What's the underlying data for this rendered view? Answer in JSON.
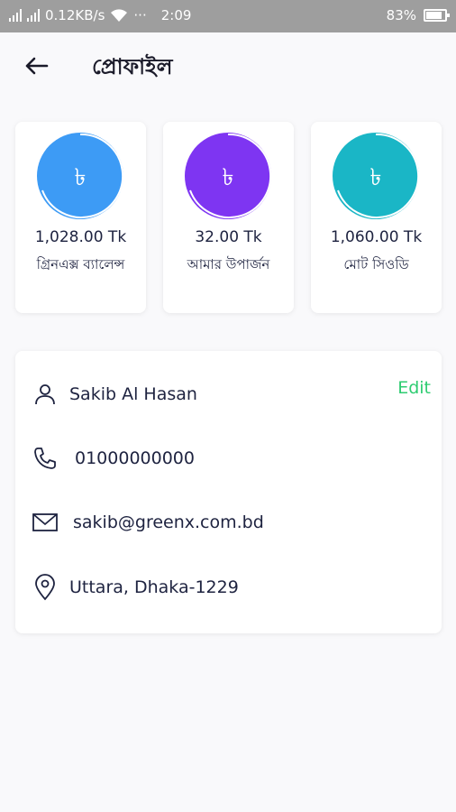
{
  "status_bar": {
    "network_speed": "0.12KB/s",
    "dots": "···",
    "time": "2:09",
    "battery": "83%"
  },
  "header": {
    "title": "প্রোফাইল"
  },
  "currency_symbol": "৳",
  "cards": [
    {
      "amount": "1,028.00 Tk",
      "label": "গ্রিনএক্স ব্যালেন্স",
      "color": "#3d9bf5"
    },
    {
      "amount": "32.00 Tk",
      "label": "আমার উপার্জন",
      "color": "#7e35f2"
    },
    {
      "amount": "1,060.00 Tk",
      "label": "মোট সিওডি",
      "color": "#1ab6c6"
    }
  ],
  "profile": {
    "edit_label": "Edit",
    "name": "Sakib Al Hasan",
    "phone": "01000000000",
    "email": "sakib@greenx.com.bd",
    "address": "Uttara, Dhaka-1229"
  },
  "colors": {
    "status_bar_bg": "#9e9e9e",
    "edit_green": "#2ecc71",
    "text": "#1e2340"
  },
  "icons": [
    "back-arrow-icon",
    "user-icon",
    "phone-icon",
    "mail-icon",
    "location-pin-icon",
    "taka-icon"
  ]
}
